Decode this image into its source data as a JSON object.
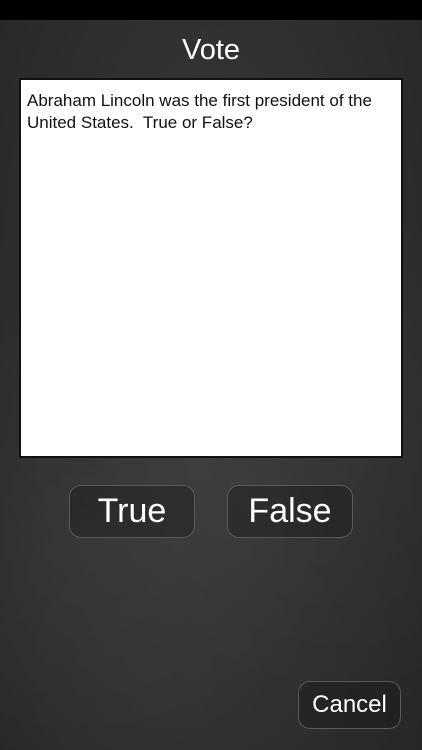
{
  "status_bar": {},
  "header": {
    "title": "Vote"
  },
  "question": {
    "text": "Abraham Lincoln was the first president of the United States.  True or False?"
  },
  "answers": {
    "true_label": "True",
    "false_label": "False"
  },
  "footer": {
    "cancel_label": "Cancel"
  }
}
